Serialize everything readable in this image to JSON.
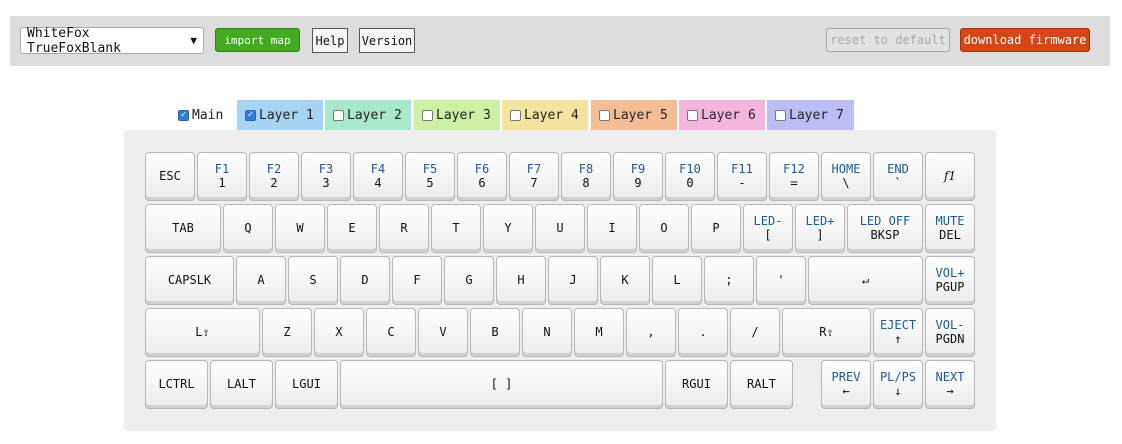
{
  "toolbar": {
    "board_select": "WhiteFox TrueFoxBlank",
    "import_label": "import map",
    "help_label": "Help",
    "version_label": "Version",
    "reset_label": "reset to default",
    "download_label": "download firmware"
  },
  "colors": {
    "import": "#44aa22",
    "download": "#d64516",
    "checkbox": "#2f7fe0"
  },
  "tabs": [
    {
      "label": "Main",
      "checked": true,
      "color": "#ffffff"
    },
    {
      "label": "Layer 1",
      "checked": true,
      "color": "#a6d4f2"
    },
    {
      "label": "Layer 2",
      "checked": false,
      "color": "#a8e8cc"
    },
    {
      "label": "Layer 3",
      "checked": false,
      "color": "#cdf0a4"
    },
    {
      "label": "Layer 4",
      "checked": false,
      "color": "#f4e4a0"
    },
    {
      "label": "Layer 5",
      "checked": false,
      "color": "#f5bd96"
    },
    {
      "label": "Layer 6",
      "checked": false,
      "color": "#f4b6dc"
    },
    {
      "label": "Layer 7",
      "checked": false,
      "color": "#bdbdf5"
    }
  ],
  "keys": {
    "row0": [
      {
        "sub": "",
        "main": "ESC"
      },
      {
        "sub": "F1",
        "main": "1"
      },
      {
        "sub": "F2",
        "main": "2"
      },
      {
        "sub": "F3",
        "main": "3"
      },
      {
        "sub": "F4",
        "main": "4"
      },
      {
        "sub": "F5",
        "main": "5"
      },
      {
        "sub": "F6",
        "main": "6"
      },
      {
        "sub": "F7",
        "main": "7"
      },
      {
        "sub": "F8",
        "main": "8"
      },
      {
        "sub": "F9",
        "main": "9"
      },
      {
        "sub": "F10",
        "main": "0"
      },
      {
        "sub": "F11",
        "main": "-"
      },
      {
        "sub": "F12",
        "main": "="
      },
      {
        "sub": "HOME",
        "main": "\\"
      },
      {
        "sub": "END",
        "main": "`"
      },
      {
        "sub": "",
        "main": "f1"
      }
    ],
    "row1": [
      {
        "sub": "",
        "main": "TAB"
      },
      {
        "sub": "",
        "main": "Q"
      },
      {
        "sub": "",
        "main": "W"
      },
      {
        "sub": "",
        "main": "E"
      },
      {
        "sub": "",
        "main": "R"
      },
      {
        "sub": "",
        "main": "T"
      },
      {
        "sub": "",
        "main": "Y"
      },
      {
        "sub": "",
        "main": "U"
      },
      {
        "sub": "",
        "main": "I"
      },
      {
        "sub": "",
        "main": "O"
      },
      {
        "sub": "",
        "main": "P"
      },
      {
        "sub": "LED-",
        "main": "["
      },
      {
        "sub": "LED+",
        "main": "]"
      },
      {
        "sub": "LED OFF",
        "main": "BKSP"
      },
      {
        "sub": "MUTE",
        "main": "DEL"
      }
    ],
    "row2": [
      {
        "sub": "",
        "main": "CAPSLK"
      },
      {
        "sub": "",
        "main": "A"
      },
      {
        "sub": "",
        "main": "S"
      },
      {
        "sub": "",
        "main": "D"
      },
      {
        "sub": "",
        "main": "F"
      },
      {
        "sub": "",
        "main": "G"
      },
      {
        "sub": "",
        "main": "H"
      },
      {
        "sub": "",
        "main": "J"
      },
      {
        "sub": "",
        "main": "K"
      },
      {
        "sub": "",
        "main": "L"
      },
      {
        "sub": "",
        "main": ";"
      },
      {
        "sub": "",
        "main": "'"
      },
      {
        "sub": "",
        "main": "↵"
      },
      {
        "sub": "VOL+",
        "main": "PGUP"
      }
    ],
    "row3": [
      {
        "sub": "",
        "main": "L⇧"
      },
      {
        "sub": "",
        "main": "Z"
      },
      {
        "sub": "",
        "main": "X"
      },
      {
        "sub": "",
        "main": "C"
      },
      {
        "sub": "",
        "main": "V"
      },
      {
        "sub": "",
        "main": "B"
      },
      {
        "sub": "",
        "main": "N"
      },
      {
        "sub": "",
        "main": "M"
      },
      {
        "sub": "",
        "main": ","
      },
      {
        "sub": "",
        "main": "."
      },
      {
        "sub": "",
        "main": "/"
      },
      {
        "sub": "",
        "main": "R⇧"
      },
      {
        "sub": "EJECT",
        "main": "↑"
      },
      {
        "sub": "VOL-",
        "main": "PGDN"
      }
    ],
    "row4": [
      {
        "sub": "",
        "main": "LCTRL"
      },
      {
        "sub": "",
        "main": "LALT"
      },
      {
        "sub": "",
        "main": "LGUI"
      },
      {
        "sub": "",
        "main": "[ ]"
      },
      {
        "sub": "",
        "main": "RGUI"
      },
      {
        "sub": "",
        "main": "RALT"
      },
      {
        "sub": "PREV",
        "main": "←"
      },
      {
        "sub": "PL/PS",
        "main": "↓"
      },
      {
        "sub": "NEXT",
        "main": "→"
      }
    ]
  }
}
